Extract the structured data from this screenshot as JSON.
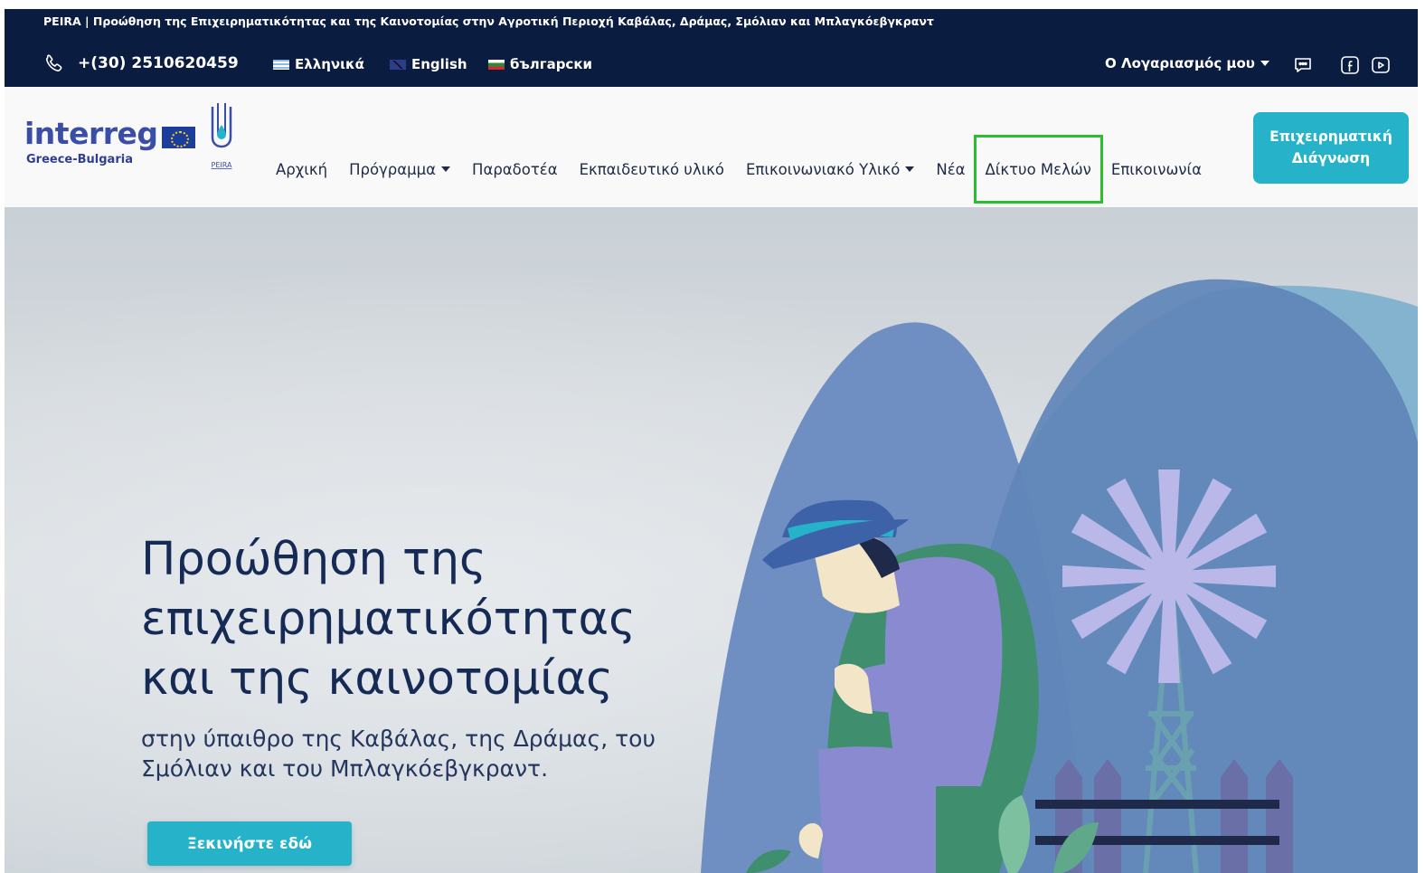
{
  "topbar": {
    "tagline": "PEIRA | Προώθηση της Επιχειρηματικότητας και της Καινοτομίας στην Αγροτική Περιοχή Καβάλας, Δράμας, Σμόλιαν και Μπλαγκόεβγκραντ",
    "phone": "+(30) 2510620459",
    "languages": [
      {
        "label": "Ελληνικά",
        "flag": "greece-flag"
      },
      {
        "label": "English",
        "flag": "uk-flag"
      },
      {
        "label": "български",
        "flag": "bulgaria-flag"
      }
    ],
    "account_label": "Ο Λογαριασμός μου",
    "icons": [
      "chat-icon",
      "facebook-icon",
      "youtube-icon"
    ]
  },
  "header": {
    "logo": {
      "brand": "interreg",
      "region": "Greece-Bulgaria",
      "project_mark": "PEIRA"
    },
    "nav": [
      {
        "label": "Αρχική",
        "dropdown": false
      },
      {
        "label": "Πρόγραμμα",
        "dropdown": true
      },
      {
        "label": "Παραδοτέα",
        "dropdown": false
      },
      {
        "label": "Εκπαιδευτικό υλικό",
        "dropdown": false
      },
      {
        "label": "Επικοινωνιακό Υλικό",
        "dropdown": true
      },
      {
        "label": "Νέα",
        "dropdown": false
      },
      {
        "label": "Δίκτυο Μελών",
        "dropdown": false,
        "highlighted": true
      },
      {
        "label": "Επικοινωνία",
        "dropdown": false
      }
    ],
    "cta_label": "Επιχειρηματική Διάγνωση"
  },
  "hero": {
    "title": "Προώθηση της επιχειρηματικότητας και της καινοτομίας",
    "subtitle": "στην ύπαιθρο της Καβάλας, της Δράμας, του Σμόλιαν και του Μπλαγκόεβγκραντ.",
    "cta_label": "Ξεκινήστε εδώ"
  },
  "colors": {
    "topbar_bg": "#0a1c3f",
    "accent": "#26b3c9",
    "title_text": "#152a55",
    "highlight_outline": "#2bbf2b"
  }
}
